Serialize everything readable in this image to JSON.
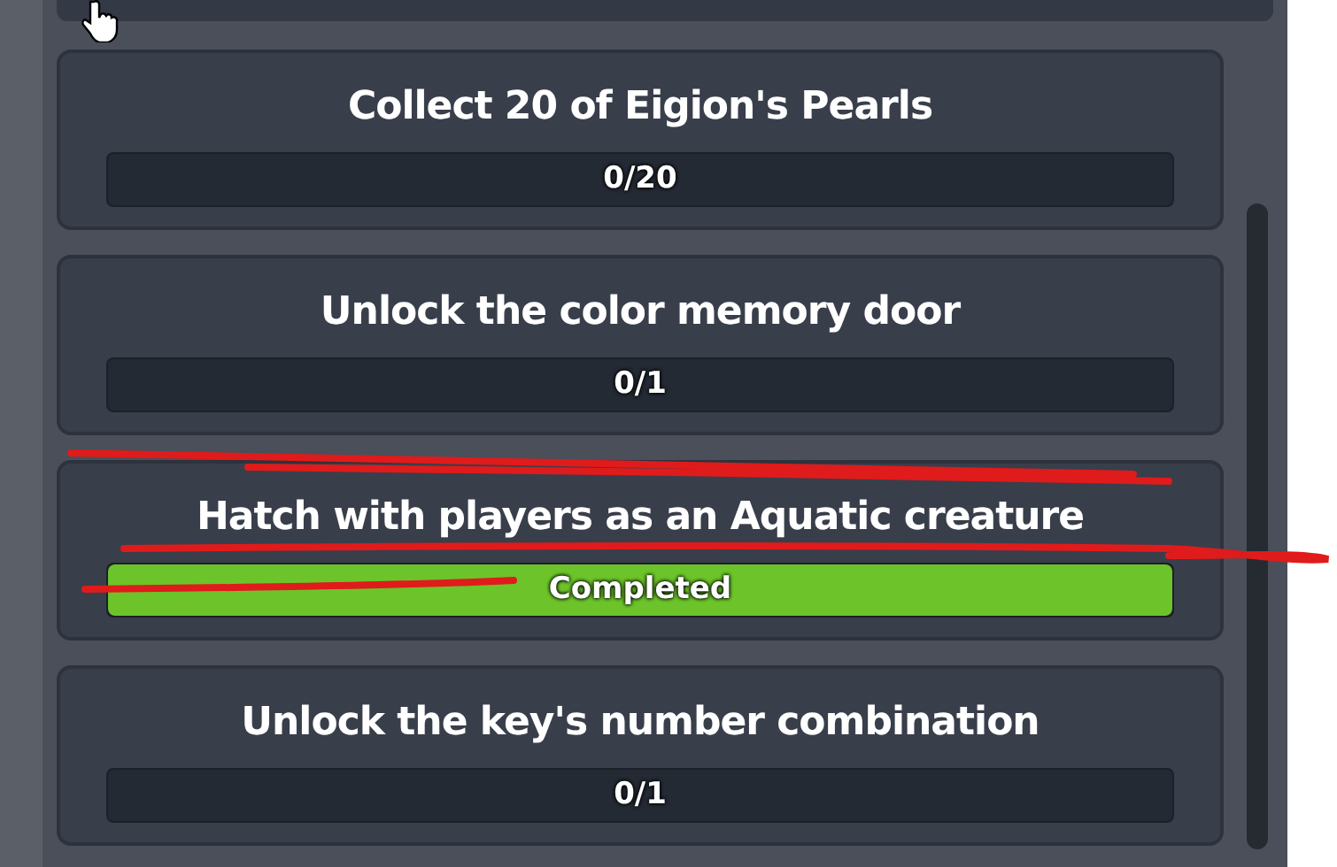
{
  "quests": [
    {
      "title": "Collect 20 of Eigion's Pearls",
      "progress": "0/20",
      "level": 0
    },
    {
      "title": "Unlock the color memory door",
      "progress": "0/1",
      "level": 0
    },
    {
      "title": "Hatch with players as an Aquatic creature",
      "progress": "Completed",
      "level": 1
    },
    {
      "title": "Unlock the key's number combination",
      "progress": "0/1",
      "level": 0
    }
  ]
}
